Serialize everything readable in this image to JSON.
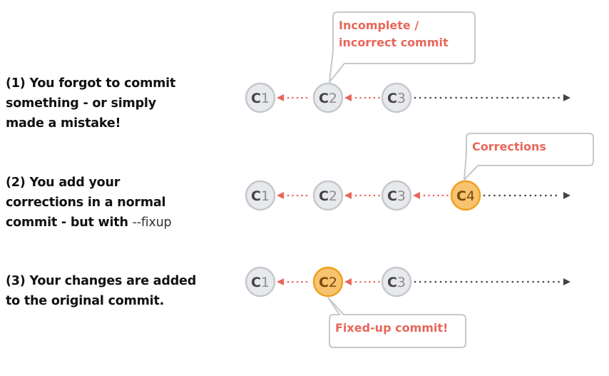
{
  "colors": {
    "accent": "#e8665a",
    "node_fill": "#e8e9ec",
    "node_stroke": "#c5c8cc",
    "node_text": "#444444",
    "highlight_fill": "#f7c36e",
    "highlight_stroke": "#f0a020",
    "highlight_text": "#7a4a0a",
    "timeline": "#444444"
  },
  "steps": [
    {
      "number": "(1)",
      "lines": [
        "You forgot to commit",
        "something - or simply",
        "made a mistake!"
      ],
      "commits": [
        "C1",
        "C2",
        "C3"
      ],
      "highlight": null,
      "callout": {
        "target": "C2",
        "lines": [
          "Incomplete /",
          "incorrect commit"
        ],
        "position": "above"
      }
    },
    {
      "number": "(2)",
      "lines": [
        "You add your",
        "corrections in a normal",
        "commit - but with "
      ],
      "flag": "--fixup",
      "commits": [
        "C1",
        "C2",
        "C3",
        "C4"
      ],
      "highlight": "C4",
      "callout": {
        "target": "C4",
        "lines": [
          "Corrections"
        ],
        "position": "above"
      }
    },
    {
      "number": "(3)",
      "lines": [
        "Your changes are added",
        "to the original commit."
      ],
      "commits": [
        "C1",
        "C2",
        "C3"
      ],
      "highlight": "C2",
      "callout": {
        "target": "C2",
        "lines": [
          "Fixed-up commit!"
        ],
        "position": "below"
      }
    }
  ]
}
